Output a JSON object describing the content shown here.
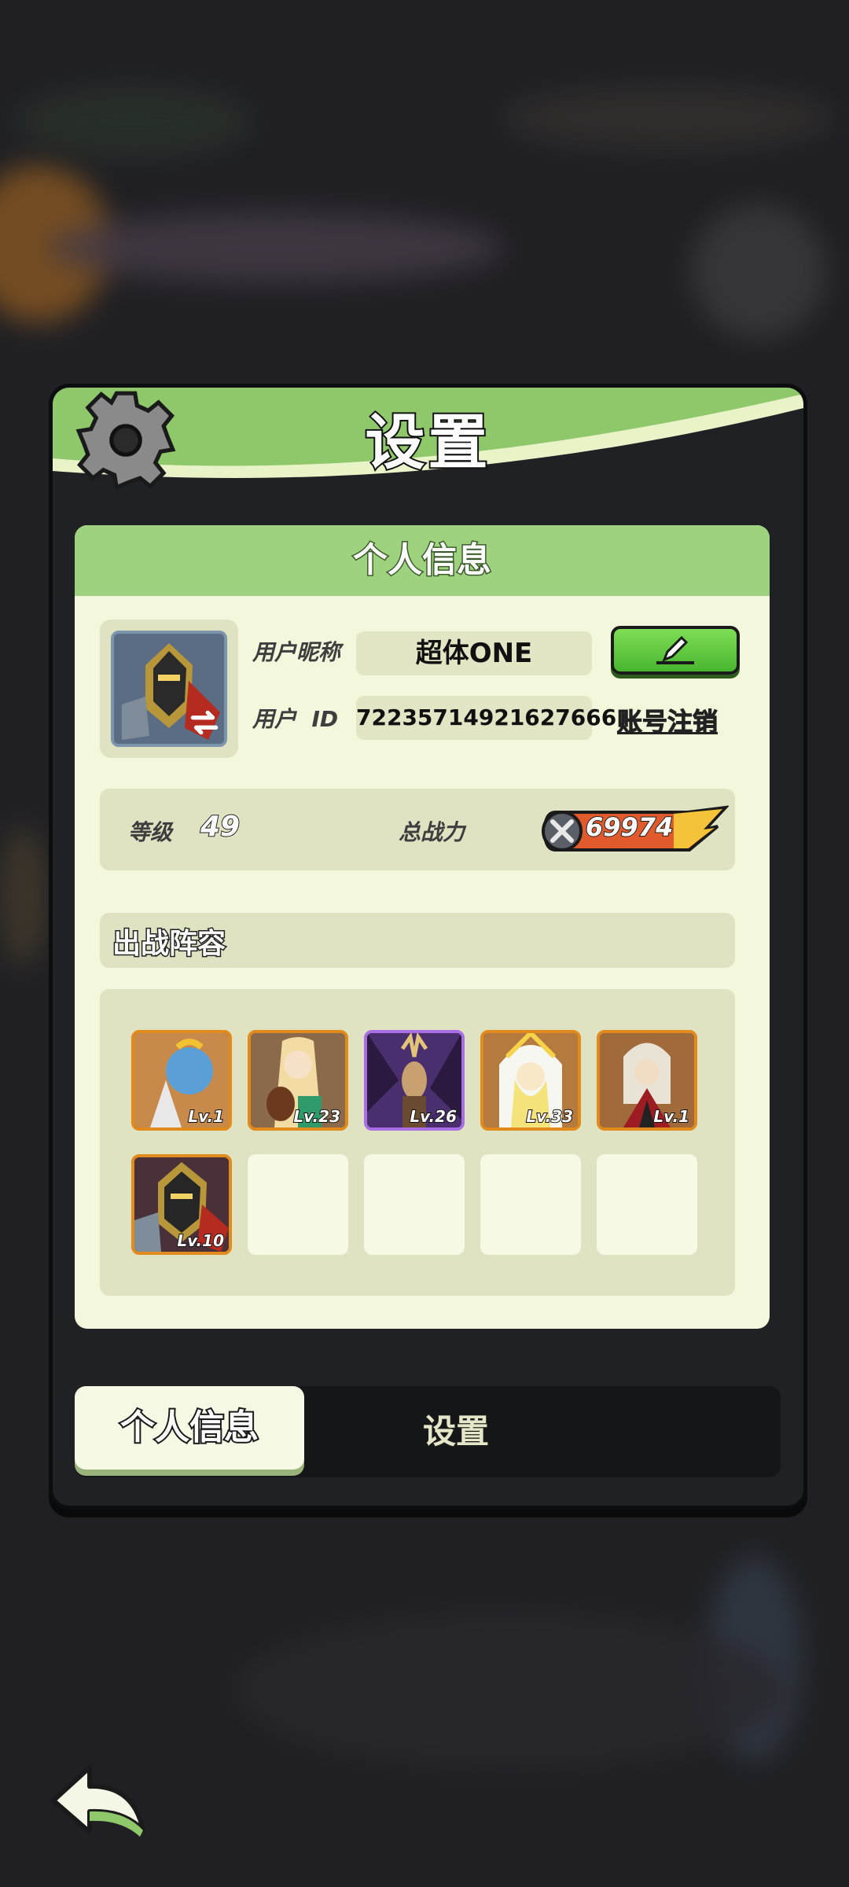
{
  "dialog": {
    "title": "设置",
    "gear_icon": "gear-icon"
  },
  "profile": {
    "section_title": "个人信息",
    "nickname_label": "用户昵称",
    "nickname": "超体ONE",
    "id_label": "用户  ID",
    "user_id": "72235714921627666",
    "logout_label": "账号注销",
    "edit_icon": "pencil-icon",
    "level_label": "等级",
    "level": "49",
    "power_label": "总战力",
    "power": "69974"
  },
  "lineup": {
    "title": "出战阵容",
    "heroes": [
      {
        "level": "Lv.1",
        "frame": "orange"
      },
      {
        "level": "Lv.23",
        "frame": "orange"
      },
      {
        "level": "Lv.26",
        "frame": "purple"
      },
      {
        "level": "Lv.33",
        "frame": "orange"
      },
      {
        "level": "Lv.1",
        "frame": "orange"
      },
      {
        "level": "Lv.10",
        "frame": "orange"
      }
    ],
    "empty_slots": 4
  },
  "tabs": {
    "active": "个人信息",
    "other": "设置"
  },
  "colors": {
    "header_green": "#8fc76b",
    "panel_bg": "#f3f8dc",
    "frame_orange": "#e08b1c",
    "frame_purple": "#a96ee4",
    "button_green": "#49b52e"
  }
}
